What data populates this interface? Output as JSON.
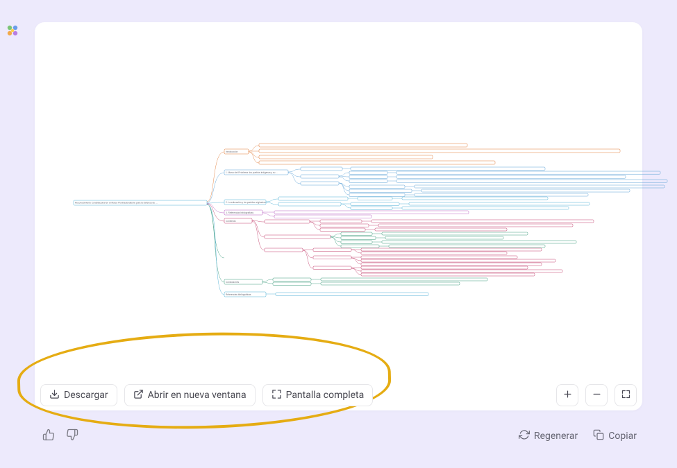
{
  "toolbar": {
    "download_label": "Descargar",
    "open_new_window_label": "Abrir en nueva ventana",
    "fullscreen_label": "Pantalla completa"
  },
  "footer": {
    "regenerate_label": "Regenerar",
    "copy_label": "Copiar"
  },
  "mindmap": {
    "root": "Reconocimiento Constitucional en el Marco Plurinacionalismo para la Defensa de los Derechos de los Pueblos Indígenas en el Perú",
    "colors": {
      "root": "#4aaed4",
      "b1": "#e07a36",
      "b2": "#5aa0d6",
      "b3": "#4aaed4",
      "b4": "#b55bbf",
      "b5": "#c23d6b",
      "b6": "#3a9a7a",
      "b7": "#4aaed4",
      "text": "#6c6c76"
    }
  }
}
